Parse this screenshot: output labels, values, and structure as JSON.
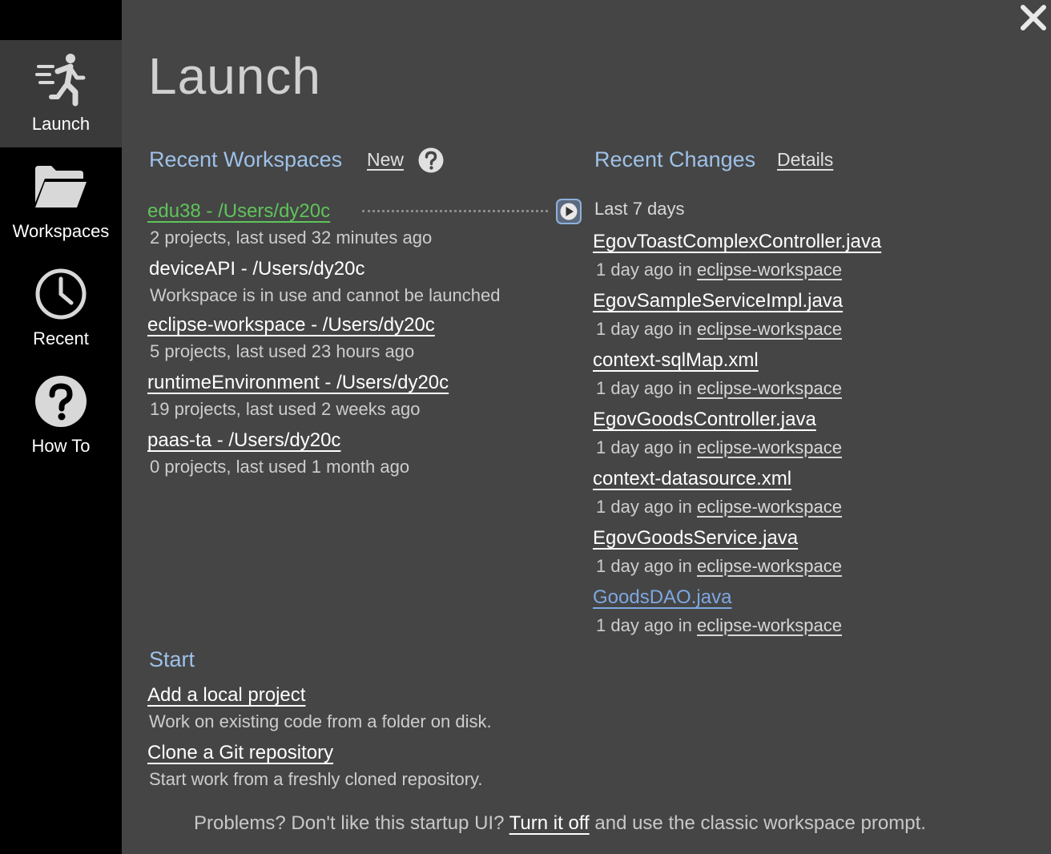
{
  "sidebar": {
    "items": [
      {
        "label": "Launch",
        "icon": "running-person-icon",
        "active": true
      },
      {
        "label": "Workspaces",
        "icon": "folder-open-icon",
        "active": false
      },
      {
        "label": "Recent",
        "icon": "clock-icon",
        "active": false
      },
      {
        "label": "How To",
        "icon": "question-circle-icon",
        "active": false
      }
    ]
  },
  "page": {
    "title": "Launch"
  },
  "workspaces": {
    "title": "Recent Workspaces",
    "new_label": "New",
    "items": [
      {
        "name": "edu38 - /Users/dy20c",
        "desc": "2 projects, last used 32 minutes ago"
      },
      {
        "name": "deviceAPI - /Users/dy20c",
        "desc": "Workspace is in use and cannot be launched"
      },
      {
        "name": "eclipse-workspace - /Users/dy20c",
        "desc": "5 projects, last used 23 hours ago"
      },
      {
        "name": "runtimeEnvironment - /Users/dy20c",
        "desc": "19 projects, last used 2 weeks ago"
      },
      {
        "name": "paas-ta - /Users/dy20c",
        "desc": "0 projects, last used 1 month ago"
      }
    ]
  },
  "changes": {
    "title": "Recent Changes",
    "details_label": "Details",
    "period": "Last 7 days",
    "items": [
      {
        "file": "EgovToastComplexController.java",
        "when": "1 day ago in",
        "workspace": "eclipse-workspace"
      },
      {
        "file": "EgovSampleServiceImpl.java",
        "when": "1 day ago in",
        "workspace": "eclipse-workspace"
      },
      {
        "file": "context-sqlMap.xml",
        "when": "1 day ago in",
        "workspace": "eclipse-workspace"
      },
      {
        "file": "EgovGoodsController.java",
        "when": "1 day ago in",
        "workspace": "eclipse-workspace"
      },
      {
        "file": "context-datasource.xml",
        "when": "1 day ago in",
        "workspace": "eclipse-workspace"
      },
      {
        "file": "EgovGoodsService.java",
        "when": "1 day ago in",
        "workspace": "eclipse-workspace"
      },
      {
        "file": "GoodsDAO.java",
        "when": "1 day ago in",
        "workspace": "eclipse-workspace"
      }
    ]
  },
  "start": {
    "title": "Start",
    "items": [
      {
        "label": "Add a local project",
        "desc": "Work on existing code from a folder on disk."
      },
      {
        "label": "Clone a Git repository",
        "desc": "Start work from a freshly cloned repository."
      }
    ]
  },
  "footer": {
    "prefix": "Problems? Don't like this startup UI?",
    "link": "Turn it off",
    "suffix": "and use the classic workspace prompt."
  },
  "colors": {
    "background": "#454545",
    "sidebar": "#000000",
    "section_title": "#9ec1e8",
    "highlight_green": "#5fc45a",
    "link_blue": "#7ea7e0"
  }
}
